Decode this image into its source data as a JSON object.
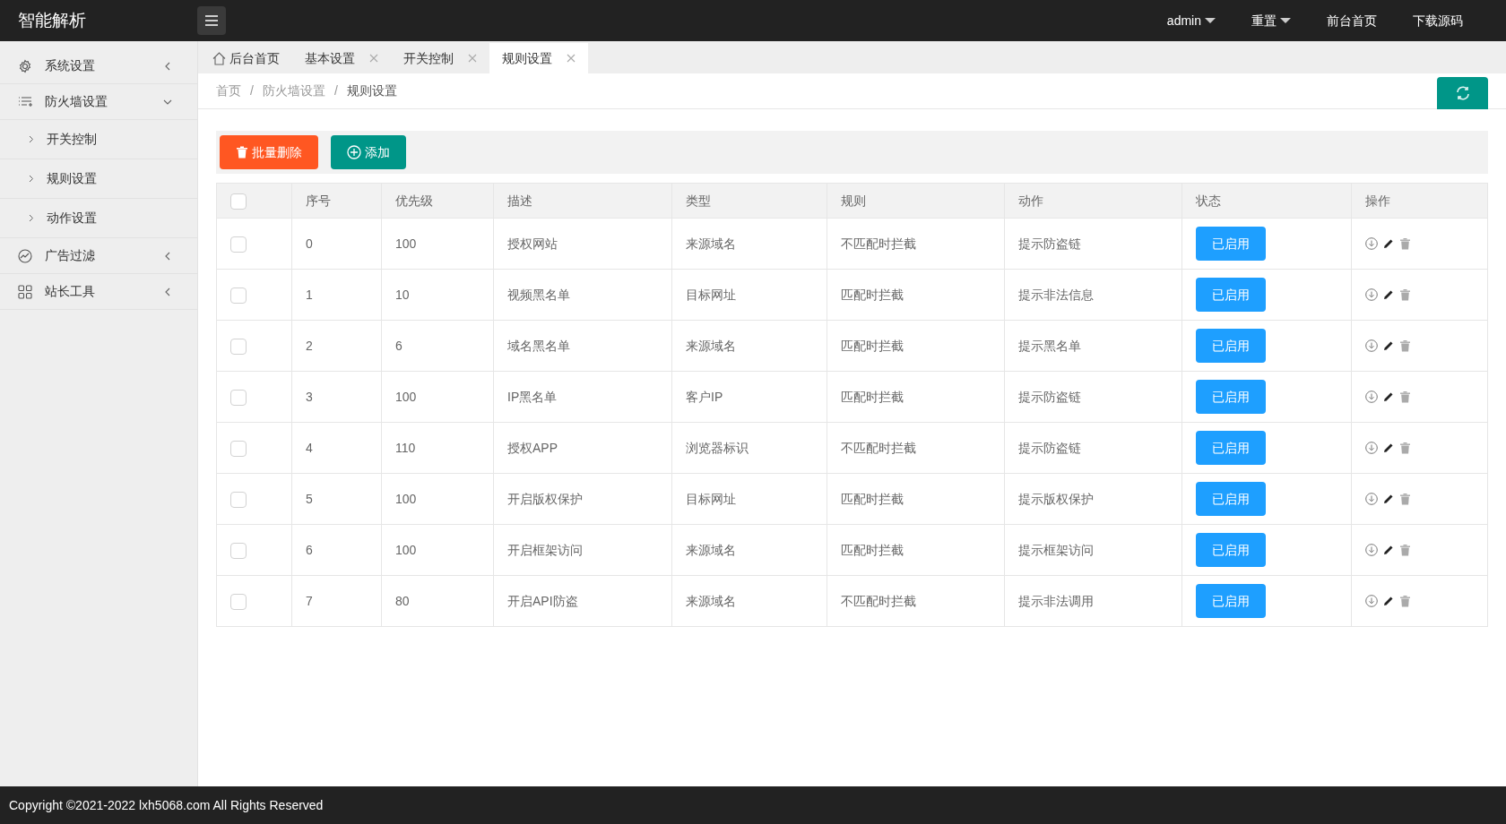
{
  "header": {
    "logo": "智能解析",
    "nav": [
      {
        "label": "admin",
        "dropdown": true
      },
      {
        "label": "重置",
        "dropdown": true
      },
      {
        "label": "前台首页",
        "dropdown": false
      },
      {
        "label": "下载源码",
        "dropdown": false
      }
    ]
  },
  "sidebar": {
    "items": [
      {
        "label": "系统设置",
        "expanded": false
      },
      {
        "label": "防火墙设置",
        "expanded": true,
        "children": [
          {
            "label": "开关控制"
          },
          {
            "label": "规则设置"
          },
          {
            "label": "动作设置"
          }
        ]
      },
      {
        "label": "广告过滤",
        "expanded": false
      },
      {
        "label": "站长工具",
        "expanded": false
      }
    ]
  },
  "tabs": [
    {
      "label": "后台首页",
      "kind": "home",
      "selected": false
    },
    {
      "label": "基本设置",
      "kind": "closable",
      "selected": false
    },
    {
      "label": "开关控制",
      "kind": "closable",
      "selected": false
    },
    {
      "label": "规则设置",
      "kind": "closable",
      "selected": true
    }
  ],
  "breadcrumb": [
    {
      "kind": "link",
      "text": "首页"
    },
    {
      "kind": "separator",
      "text": "/"
    },
    {
      "kind": "link",
      "text": "防火墙设置"
    },
    {
      "kind": "separator",
      "text": "/"
    },
    {
      "kind": "current",
      "text": "规则设置"
    }
  ],
  "toolbar": {
    "batch_delete": "批量删除",
    "add": "添加"
  },
  "table": {
    "select_all_checked": false,
    "columns": [
      "序号",
      "优先级",
      "描述",
      "类型",
      "规则",
      "动作",
      "状态",
      "操作"
    ],
    "rows": [
      {
        "checked": false,
        "cells": [
          "0",
          "100",
          "授权网站",
          "来源域名",
          "不匹配时拦截",
          "提示防盗链"
        ],
        "status": "已启用"
      },
      {
        "checked": false,
        "cells": [
          "1",
          "10",
          "视频黑名单",
          "目标网址",
          "匹配时拦截",
          "提示非法信息"
        ],
        "status": "已启用"
      },
      {
        "checked": false,
        "cells": [
          "2",
          "6",
          "域名黑名单",
          "来源域名",
          "匹配时拦截",
          "提示黑名单"
        ],
        "status": "已启用"
      },
      {
        "checked": false,
        "cells": [
          "3",
          "100",
          "IP黑名单",
          "客户IP",
          "匹配时拦截",
          "提示防盗链"
        ],
        "status": "已启用"
      },
      {
        "checked": false,
        "cells": [
          "4",
          "110",
          "授权APP",
          "浏览器标识",
          "不匹配时拦截",
          "提示防盗链"
        ],
        "status": "已启用"
      },
      {
        "checked": false,
        "cells": [
          "5",
          "100",
          "开启版权保护",
          "目标网址",
          "匹配时拦截",
          "提示版权保护"
        ],
        "status": "已启用"
      },
      {
        "checked": false,
        "cells": [
          "6",
          "100",
          "开启框架访问",
          "来源域名",
          "匹配时拦截",
          "提示框架访问"
        ],
        "status": "已启用"
      },
      {
        "checked": false,
        "cells": [
          "7",
          "80",
          "开启API防盗",
          "来源域名",
          "不匹配时拦截",
          "提示非法调用"
        ],
        "status": "已启用"
      }
    ]
  },
  "footer": "Copyright ©2021-2022 lxh5068.com All Rights Reserved"
}
